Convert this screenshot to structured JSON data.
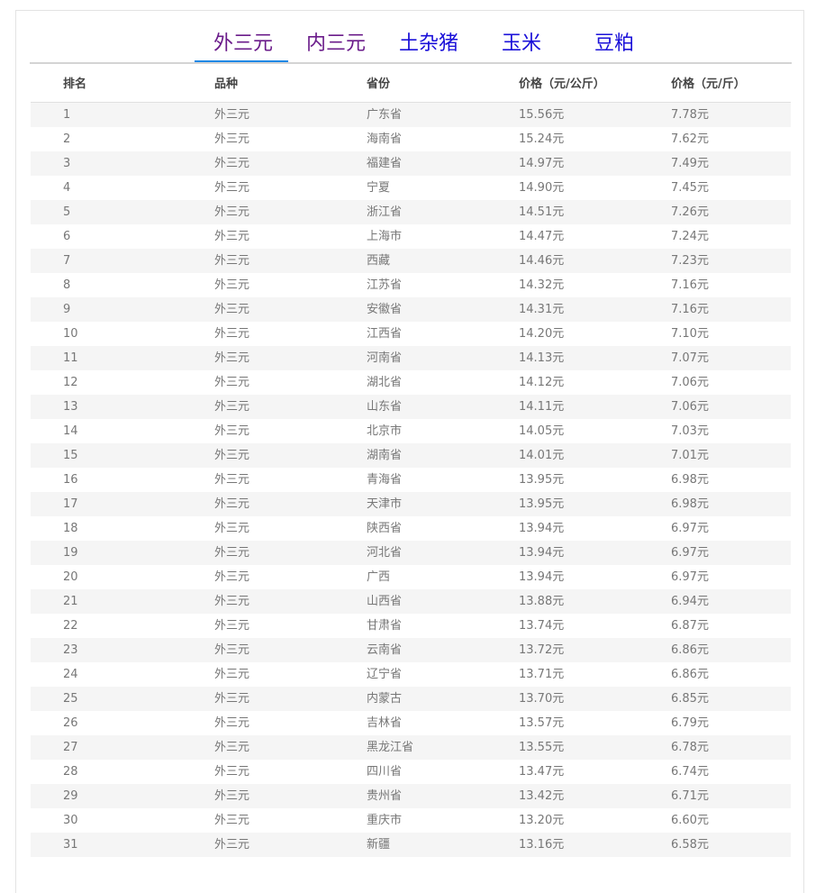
{
  "tabs": [
    {
      "label": "外三元",
      "state": "active"
    },
    {
      "label": "内三元",
      "state": "visited"
    },
    {
      "label": "土杂猪",
      "state": "link"
    },
    {
      "label": "玉米",
      "state": "link"
    },
    {
      "label": "豆粕",
      "state": "link"
    }
  ],
  "colors": {
    "active_underline": "#1e88e5",
    "visited_tab": "#6a1b8a",
    "link_tab": "#1a10d9",
    "row_stripe": "#f5f5f5"
  },
  "table": {
    "headers": [
      "排名",
      "品种",
      "省份",
      "价格（元/公斤）",
      "价格（元/斤）"
    ],
    "rows": [
      [
        "1",
        "外三元",
        "广东省",
        "15.56元",
        "7.78元"
      ],
      [
        "2",
        "外三元",
        "海南省",
        "15.24元",
        "7.62元"
      ],
      [
        "3",
        "外三元",
        "福建省",
        "14.97元",
        "7.49元"
      ],
      [
        "4",
        "外三元",
        "宁夏",
        "14.90元",
        "7.45元"
      ],
      [
        "5",
        "外三元",
        "浙江省",
        "14.51元",
        "7.26元"
      ],
      [
        "6",
        "外三元",
        "上海市",
        "14.47元",
        "7.24元"
      ],
      [
        "7",
        "外三元",
        "西藏",
        "14.46元",
        "7.23元"
      ],
      [
        "8",
        "外三元",
        "江苏省",
        "14.32元",
        "7.16元"
      ],
      [
        "9",
        "外三元",
        "安徽省",
        "14.31元",
        "7.16元"
      ],
      [
        "10",
        "外三元",
        "江西省",
        "14.20元",
        "7.10元"
      ],
      [
        "11",
        "外三元",
        "河南省",
        "14.13元",
        "7.07元"
      ],
      [
        "12",
        "外三元",
        "湖北省",
        "14.12元",
        "7.06元"
      ],
      [
        "13",
        "外三元",
        "山东省",
        "14.11元",
        "7.06元"
      ],
      [
        "14",
        "外三元",
        "北京市",
        "14.05元",
        "7.03元"
      ],
      [
        "15",
        "外三元",
        "湖南省",
        "14.01元",
        "7.01元"
      ],
      [
        "16",
        "外三元",
        "青海省",
        "13.95元",
        "6.98元"
      ],
      [
        "17",
        "外三元",
        "天津市",
        "13.95元",
        "6.98元"
      ],
      [
        "18",
        "外三元",
        "陕西省",
        "13.94元",
        "6.97元"
      ],
      [
        "19",
        "外三元",
        "河北省",
        "13.94元",
        "6.97元"
      ],
      [
        "20",
        "外三元",
        "广西",
        "13.94元",
        "6.97元"
      ],
      [
        "21",
        "外三元",
        "山西省",
        "13.88元",
        "6.94元"
      ],
      [
        "22",
        "外三元",
        "甘肃省",
        "13.74元",
        "6.87元"
      ],
      [
        "23",
        "外三元",
        "云南省",
        "13.72元",
        "6.86元"
      ],
      [
        "24",
        "外三元",
        "辽宁省",
        "13.71元",
        "6.86元"
      ],
      [
        "25",
        "外三元",
        "内蒙古",
        "13.70元",
        "6.85元"
      ],
      [
        "26",
        "外三元",
        "吉林省",
        "13.57元",
        "6.79元"
      ],
      [
        "27",
        "外三元",
        "黑龙江省",
        "13.55元",
        "6.78元"
      ],
      [
        "28",
        "外三元",
        "四川省",
        "13.47元",
        "6.74元"
      ],
      [
        "29",
        "外三元",
        "贵州省",
        "13.42元",
        "6.71元"
      ],
      [
        "30",
        "外三元",
        "重庆市",
        "13.20元",
        "6.60元"
      ],
      [
        "31",
        "外三元",
        "新疆",
        "13.16元",
        "6.58元"
      ]
    ]
  }
}
